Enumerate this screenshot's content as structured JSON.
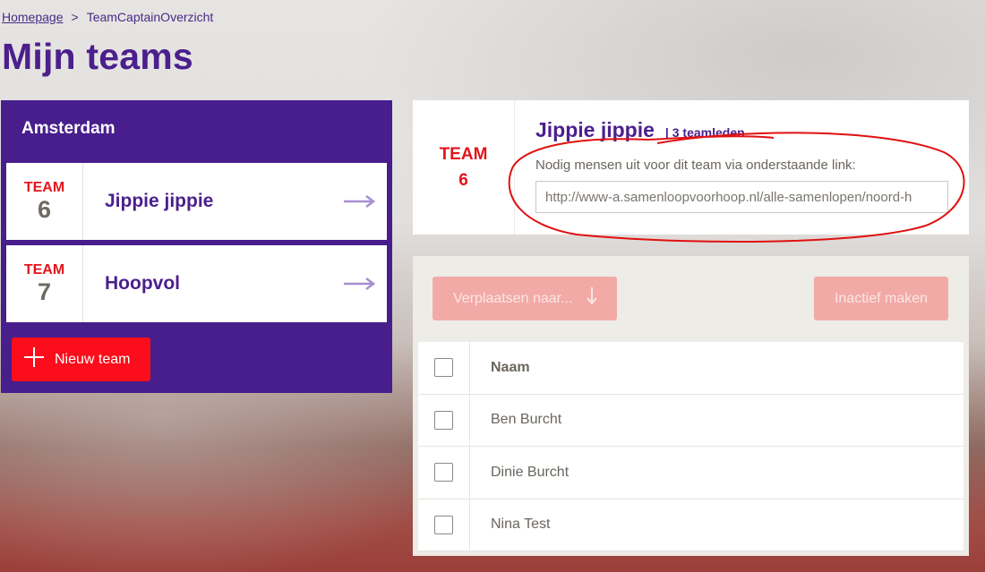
{
  "breadcrumb": {
    "home": "Homepage",
    "separator": ">",
    "current": "TeamCaptainOverzicht"
  },
  "page_title": "Mijn teams",
  "left_panel": {
    "location": "Amsterdam",
    "teams": [
      {
        "label": "TEAM",
        "number": "6",
        "name": "Jippie jippie"
      },
      {
        "label": "TEAM",
        "number": "7",
        "name": "Hoopvol"
      }
    ],
    "new_team_label": "Nieuw team"
  },
  "team_detail": {
    "label": "TEAM",
    "number": "6",
    "name": "Jippie jippie",
    "member_count": "| 3 teamleden",
    "invite_text": "Nodig mensen uit voor dit team via onderstaande link:",
    "invite_link": "http://www-a.samenloopvoorhoop.nl/alle-samenlopen/noord-h"
  },
  "actions": {
    "move_label": "Verplaatsen naar...",
    "inactive_label": "Inactief maken"
  },
  "members_table": {
    "header": "Naam",
    "rows": [
      "Ben Burcht",
      "Dinie Burcht",
      "Nina Test"
    ]
  },
  "colors": {
    "brand_purple": "#471e8c",
    "team_red": "#e3151b",
    "button_red": "#fb0d1b",
    "disabled_button": "#f2aaa7",
    "annotation": "#e01010"
  },
  "icons": {
    "arrow": "arrow-right-icon",
    "plus": "plus-icon",
    "down": "arrow-down-icon"
  }
}
